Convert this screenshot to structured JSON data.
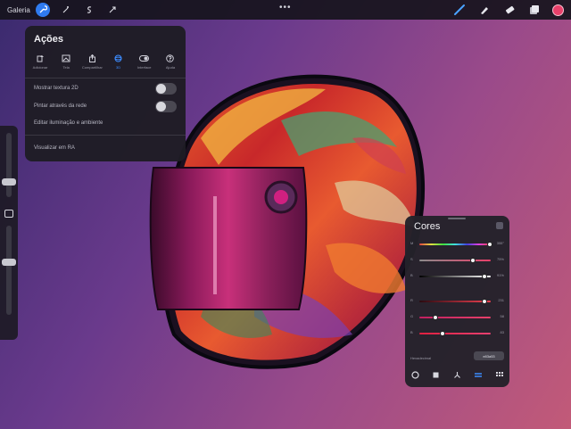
{
  "toolbar": {
    "gallery_label": "Galeria",
    "more_glyph": "•••",
    "current_color": "#e8406a",
    "accent_color": "#2f7bf0"
  },
  "actions": {
    "title": "Ações",
    "tabs": [
      {
        "label": "Adicionar",
        "icon": "add-icon"
      },
      {
        "label": "Tela",
        "icon": "canvas-icon"
      },
      {
        "label": "Compartilhar",
        "icon": "share-icon"
      },
      {
        "label": "3D",
        "icon": "3d-icon",
        "active": true
      },
      {
        "label": "Interface",
        "icon": "interface-icon"
      },
      {
        "label": "Ajuda",
        "icon": "help-icon"
      }
    ],
    "rows": {
      "show_2d_texture": "Mostrar textura 2D",
      "paint_through_mesh": "Pintar através da rede",
      "edit_lighting": "Editar iluminação e ambiente",
      "view_in_ar": "Visualizar em RA"
    },
    "toggles": {
      "show_2d_texture": false,
      "paint_through_mesh": false
    }
  },
  "colors_panel": {
    "title": "Cores",
    "sliders": [
      {
        "key": "M",
        "value": "355°",
        "fraction": 0.99,
        "gradient": "linear-gradient(90deg,#e04040,#e0e040,#40e040,#40e0e0,#4040e0,#e040e0,#e04040)"
      },
      {
        "key": "S",
        "value": "75%",
        "fraction": 0.75,
        "gradient": "linear-gradient(90deg,#8a8a8a,#e8406a)"
      },
      {
        "key": "B",
        "value": "91%",
        "fraction": 0.91,
        "gradient": "linear-gradient(90deg,#000000,#ffffff)"
      },
      {
        "key": "R",
        "value": "231",
        "fraction": 0.91,
        "gradient": "linear-gradient(90deg,#2a0a10,#f04050)"
      },
      {
        "key": "G",
        "value": "58",
        "fraction": 0.23,
        "gradient": "linear-gradient(90deg,#c02060,#e8406a)"
      },
      {
        "key": "B",
        "value": "83",
        "fraction": 0.33,
        "gradient": "linear-gradient(90deg,#e02040,#e84070)"
      }
    ],
    "hex_label": "Hexadecimal",
    "hex_value": "e83a53",
    "modes": [
      {
        "icon": "disc-icon"
      },
      {
        "icon": "classic-icon"
      },
      {
        "icon": "harmony-icon"
      },
      {
        "icon": "value-icon",
        "active": true
      },
      {
        "icon": "palettes-icon"
      }
    ]
  },
  "sidebar": {
    "brush_size_level": 0.2,
    "opacity_level": 0.6
  }
}
